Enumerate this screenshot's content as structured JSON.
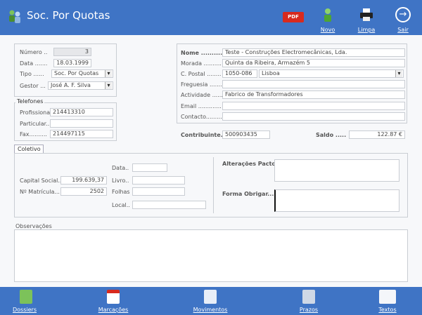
{
  "header": {
    "title": "Soc. Por Quotas",
    "pdf_label": "PDF",
    "novo_label": "Novo",
    "limpa_label": "Limpa",
    "sair_label": "Sair"
  },
  "left": {
    "numero_label": "Número ..",
    "numero_value": "3",
    "data_label": "Data .......",
    "data_value": "18.03.1999",
    "tipo_label": "Tipo ......",
    "tipo_value": "Soc. Por Quotas",
    "gestor_label": "Gestor ...",
    "gestor_value": "José A. F. Silva"
  },
  "telefones": {
    "title": "Telefones",
    "profissional_label": "Profissional.",
    "profissional_value": "214413310",
    "particular_label": "Particular..",
    "particular_value": "",
    "fax_label": "Fax..........",
    "fax_value": "214497115"
  },
  "entity": {
    "nome_label": "Nome ...........",
    "nome_value": "Teste - Construções Electromecânicas, Lda.",
    "morada_label": "Morada ..........",
    "morada_value": "Quinta da Ribeira, Armazém 5",
    "cpostal_label": "C. Postal ........",
    "cpostal_value": "1050-086",
    "localidade_value": "Lisboa",
    "freguesia_label": "Freguesia ........",
    "freguesia_value": "",
    "actividade_label": "Actividade .......",
    "actividade_value": "Fabrico de Transformadores",
    "email_label": "Email .............",
    "email_value": "",
    "contacto_label": "Contacto...........",
    "contacto_value": ""
  },
  "contribuinte": {
    "label": "Contribuinte.",
    "value": "500903435"
  },
  "saldo": {
    "label": "Saldo .....",
    "value": "122.87 €"
  },
  "coletivo": {
    "tab_label": "Coletivo",
    "capital_label": "Capital Social..",
    "capital_value": "199.639,37",
    "matricula_label": "Nº Matrícula...",
    "matricula_value": "2502",
    "data_label": "Data..",
    "data_value": "",
    "livro_label": "Livro..",
    "livro_value": "",
    "folhas_label": "Folhas",
    "folhas_value": "",
    "local_label": "Local..",
    "local_value": "",
    "alteracoes_label": "Alterações Pacto",
    "forma_label": "Forma Obrigar....",
    "observacoes_label": "Observações"
  },
  "footer": {
    "dossiers": "Dossiers",
    "marcacoes": "Marcações",
    "movimentos": "Movimentos",
    "prazos": "Prazos",
    "textos": "Textos"
  },
  "colors": {
    "header": "#3f74c5",
    "accent_red": "#d82a1e"
  }
}
